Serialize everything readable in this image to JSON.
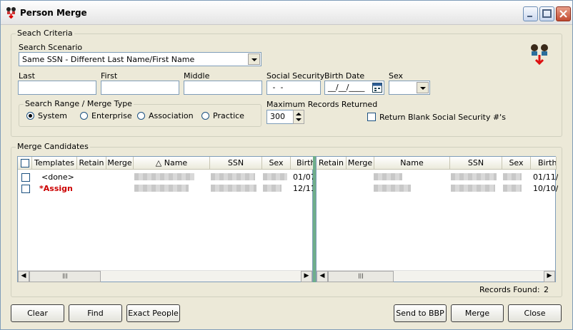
{
  "window": {
    "title": "Person Merge"
  },
  "criteria": {
    "group_label": "Seach Criteria",
    "scenario_label": "Search Scenario",
    "scenario_value": "Same SSN - Different Last Name/First Name",
    "last_label": "Last",
    "first_label": "First",
    "middle_label": "Middle",
    "ssn_label": "Social Security",
    "ssn_value": " -  -",
    "birth_label": "Birth Date",
    "birth_value": "__/__/____",
    "sex_label": "Sex",
    "range_group_label": "Search Range / Merge Type",
    "range_options": [
      "System",
      "Enterprise",
      "Association",
      "Practice"
    ],
    "max_label": "Maximum Records Returned",
    "max_value": "300",
    "return_blank_label": "Return Blank Social Security #'s"
  },
  "candidates": {
    "group_label": "Merge Candidates",
    "left_columns": [
      "Templates",
      "Retain",
      "Merge",
      "△ Name",
      "SSN",
      "Sex",
      "Birth"
    ],
    "right_columns": [
      "Retain",
      "Merge",
      "Name",
      "SSN",
      "Sex",
      "Birth"
    ],
    "left_rows": [
      {
        "template": "<done>",
        "birth": "01/07"
      },
      {
        "template": "*Assign",
        "birth": "12/11"
      }
    ],
    "right_rows": [
      {
        "birth": "01/11/"
      },
      {
        "birth": "10/10/"
      }
    ],
    "records_found_label": "Records Found:",
    "records_found_value": "2"
  },
  "buttons": {
    "clear": "Clear",
    "find": "Find",
    "exact_people": "Exact People",
    "send_bbp": "Send to BBP",
    "merge": "Merge",
    "close": "Close"
  },
  "colors": {
    "assign_red": "#cc0000"
  }
}
